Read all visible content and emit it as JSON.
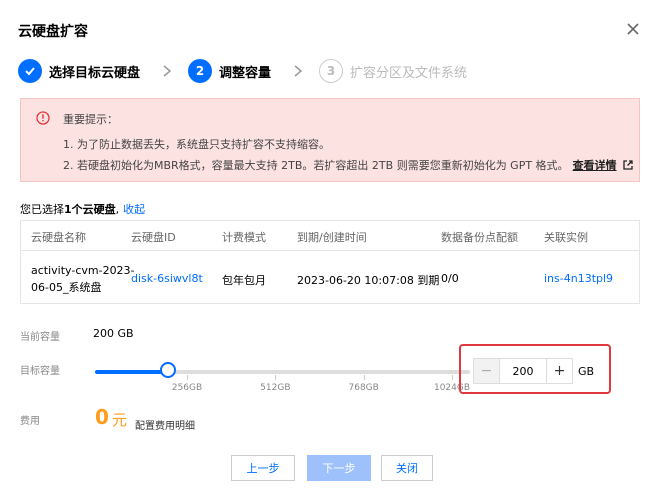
{
  "dialog": {
    "title": "云硬盘扩容"
  },
  "steps": [
    {
      "label": "选择目标云硬盘",
      "status": "done"
    },
    {
      "number": "2",
      "label": "调整容量",
      "status": "active"
    },
    {
      "number": "3",
      "label": "扩容分区及文件系统",
      "status": "todo"
    }
  ],
  "alert": {
    "title": "重要提示：",
    "line1": "1. 为了防止数据丢失，系统盘只支持扩容不支持缩容。",
    "line2": "2. 若硬盘初始化为MBR格式，容量最大支持 2TB。若扩容超出 2TB 则需要您重新初始化为 GPT 格式。",
    "link": "查看详情"
  },
  "selection": {
    "prefix": "您已选择",
    "count_text": "1个云硬盘",
    "suffix": ",",
    "collapse": "收起"
  },
  "table": {
    "headers": [
      "云硬盘名称",
      "云硬盘ID",
      "计费模式",
      "到期/创建时间",
      "数据备份点配额",
      "关联实例"
    ],
    "row": {
      "name_line1": "activity-cvm-2023-",
      "name_line2": "06-05_系统盘",
      "disk_id": "disk-6siwvl8t",
      "billing": "包年包月",
      "expiry": "2023-06-20 10:07:08 到期",
      "backup": "0/0",
      "instance": "ins-4n13tpl9"
    }
  },
  "form": {
    "current_label": "当前容量",
    "current_value": "200 GB",
    "target_label": "目标容量",
    "fee_label": "费用",
    "slider": {
      "min": 0,
      "max": 1024,
      "value": 200
    },
    "ticks": [
      "256GB",
      "512GB",
      "768GB",
      "1024GB"
    ],
    "stepper": {
      "minus": "−",
      "plus": "+",
      "value": "200",
      "unit": "GB"
    },
    "price": "0",
    "price_unit": "元",
    "price_detail": "配置费用明细"
  },
  "buttons": {
    "prev": "上一步",
    "next": "下一步",
    "close": "关闭"
  },
  "colors": {
    "primary": "#006eff",
    "alert_bg": "#fde2e2",
    "price": "#ff9c19",
    "highlight": "#e0383e",
    "disabled": "#9ec1fb"
  }
}
